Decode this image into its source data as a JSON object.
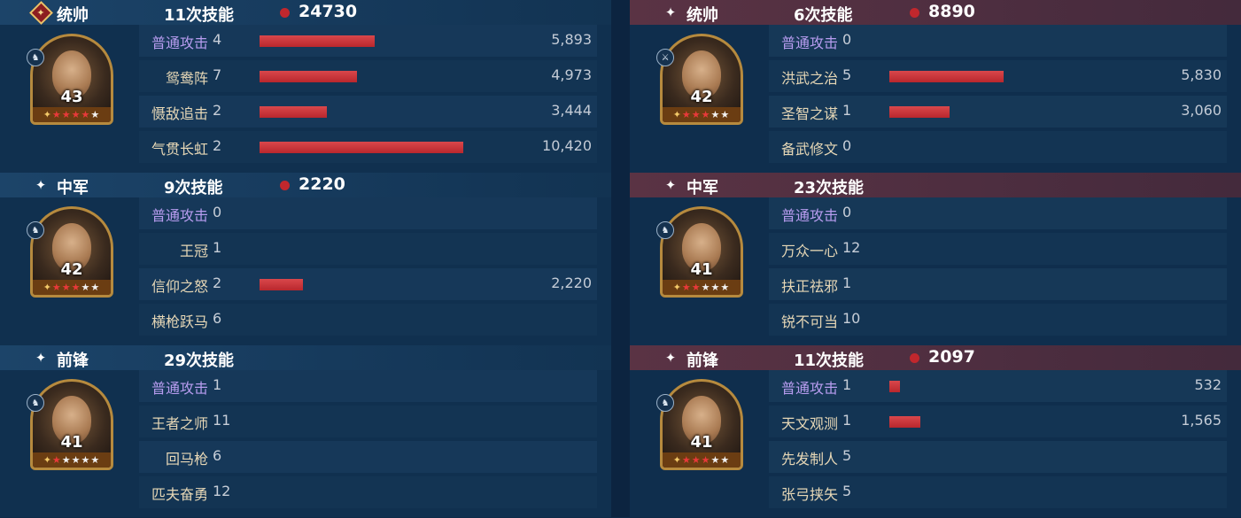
{
  "left": {
    "sections": [
      {
        "role": "统帅",
        "role_icon": "commander-diamond-icon",
        "skill_count": "11次技能",
        "damage_total": "24730",
        "hero": {
          "level": "43",
          "stars": [
            "✦",
            "★",
            "★",
            "★",
            "★",
            "★"
          ],
          "red_stars": 4,
          "badge_icon": "mount-icon"
        },
        "skills": [
          {
            "name": "普通攻击",
            "uses": "4",
            "damage": "5,893",
            "damage_value": 5893,
            "basic": true
          },
          {
            "name": "鸳鸯阵",
            "uses": "7",
            "damage": "4,973",
            "damage_value": 4973
          },
          {
            "name": "慑敌追击",
            "uses": "2",
            "damage": "3,444",
            "damage_value": 3444
          },
          {
            "name": "气贯长虹",
            "uses": "2",
            "damage": "10,420",
            "damage_value": 10420
          }
        ]
      },
      {
        "role": "中军",
        "role_icon": "sparkle-icon",
        "skill_count": "9次技能",
        "damage_total": "2220",
        "hero": {
          "level": "42",
          "stars": [
            "✦",
            "★",
            "★",
            "★",
            "★",
            "★"
          ],
          "red_stars": 3,
          "badge_icon": "mount-icon"
        },
        "skills": [
          {
            "name": "普通攻击",
            "uses": "0",
            "damage": "",
            "damage_value": 0,
            "basic": true
          },
          {
            "name": "王冠",
            "uses": "1",
            "damage": "",
            "damage_value": 0
          },
          {
            "name": "信仰之怒",
            "uses": "2",
            "damage": "2,220",
            "damage_value": 2220
          },
          {
            "name": "横枪跃马",
            "uses": "6",
            "damage": "",
            "damage_value": 0
          }
        ]
      },
      {
        "role": "前锋",
        "role_icon": "sparkle-icon",
        "skill_count": "29次技能",
        "damage_total": "",
        "hero": {
          "level": "41",
          "stars": [
            "✦",
            "★",
            "★",
            "★",
            "★",
            "★"
          ],
          "red_stars": 1,
          "badge_icon": "mount-icon"
        },
        "skills": [
          {
            "name": "普通攻击",
            "uses": "1",
            "damage": "",
            "damage_value": 0,
            "basic": true
          },
          {
            "name": "王者之师",
            "uses": "11",
            "damage": "",
            "damage_value": 0
          },
          {
            "name": "回马枪",
            "uses": "6",
            "damage": "",
            "damage_value": 0
          },
          {
            "name": "匹夫奋勇",
            "uses": "12",
            "damage": "",
            "damage_value": 0
          }
        ]
      }
    ]
  },
  "right": {
    "sections": [
      {
        "role": "统帅",
        "role_icon": "sparkle-icon",
        "skill_count": "6次技能",
        "damage_total": "8890",
        "hero": {
          "level": "42",
          "stars": [
            "✦",
            "★",
            "★",
            "★",
            "★",
            "★"
          ],
          "red_stars": 3,
          "badge_icon": "sword-icon"
        },
        "skills": [
          {
            "name": "普通攻击",
            "uses": "0",
            "damage": "",
            "damage_value": 0,
            "basic": true
          },
          {
            "name": "洪武之治",
            "uses": "5",
            "damage": "5,830",
            "damage_value": 5830
          },
          {
            "name": "圣智之谋",
            "uses": "1",
            "damage": "3,060",
            "damage_value": 3060
          },
          {
            "name": "备武修文",
            "uses": "0",
            "damage": "",
            "damage_value": 0
          }
        ]
      },
      {
        "role": "中军",
        "role_icon": "sparkle-icon",
        "skill_count": "23次技能",
        "damage_total": "",
        "hero": {
          "level": "41",
          "stars": [
            "✦",
            "★",
            "★",
            "★",
            "★",
            "★"
          ],
          "red_stars": 2,
          "badge_icon": "mount-icon"
        },
        "skills": [
          {
            "name": "普通攻击",
            "uses": "0",
            "damage": "",
            "damage_value": 0,
            "basic": true
          },
          {
            "name": "万众一心",
            "uses": "12",
            "damage": "",
            "damage_value": 0
          },
          {
            "name": "扶正祛邪",
            "uses": "1",
            "damage": "",
            "damage_value": 0
          },
          {
            "name": "锐不可当",
            "uses": "10",
            "damage": "",
            "damage_value": 0
          }
        ]
      },
      {
        "role": "前锋",
        "role_icon": "sparkle-icon",
        "skill_count": "11次技能",
        "damage_total": "2097",
        "hero": {
          "level": "41",
          "stars": [
            "✦",
            "★",
            "★",
            "★",
            "★",
            "★"
          ],
          "red_stars": 3,
          "badge_icon": "mount-icon"
        },
        "skills": [
          {
            "name": "普通攻击",
            "uses": "1",
            "damage": "532",
            "damage_value": 532,
            "basic": true
          },
          {
            "name": "天文观测",
            "uses": "1",
            "damage": "1,565",
            "damage_value": 1565
          },
          {
            "name": "先发制人",
            "uses": "5",
            "damage": "",
            "damage_value": 0
          },
          {
            "name": "张弓挟矢",
            "uses": "5",
            "damage": "",
            "damage_value": 0
          }
        ]
      }
    ]
  },
  "colors": {
    "bar": "#c8313a",
    "basic_attack": "#b89df0",
    "skill_name": "#e6d7b6"
  }
}
